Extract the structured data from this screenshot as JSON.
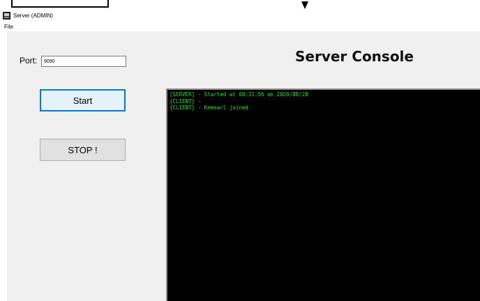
{
  "window": {
    "title": "Server (ADMIN)"
  },
  "menu": {
    "items": [
      {
        "label": "File"
      }
    ]
  },
  "form": {
    "port_label": "Port:",
    "port_value": "9090",
    "start_label": "Start",
    "stop_label": "STOP !"
  },
  "console": {
    "title": "Server Console",
    "lines": [
      "[SERVER] - Started at 08:31:56 on 2020/08/28",
      "{CLIENT} -",
      "{CLIENT} - Kemearl joined"
    ]
  },
  "colors": {
    "console_text": "#22e022",
    "console_bg": "#000000",
    "start_focus_border": "#0078d7"
  },
  "icons": {
    "app": "server-app-icon",
    "top_arrow": "down-arrow-icon"
  }
}
